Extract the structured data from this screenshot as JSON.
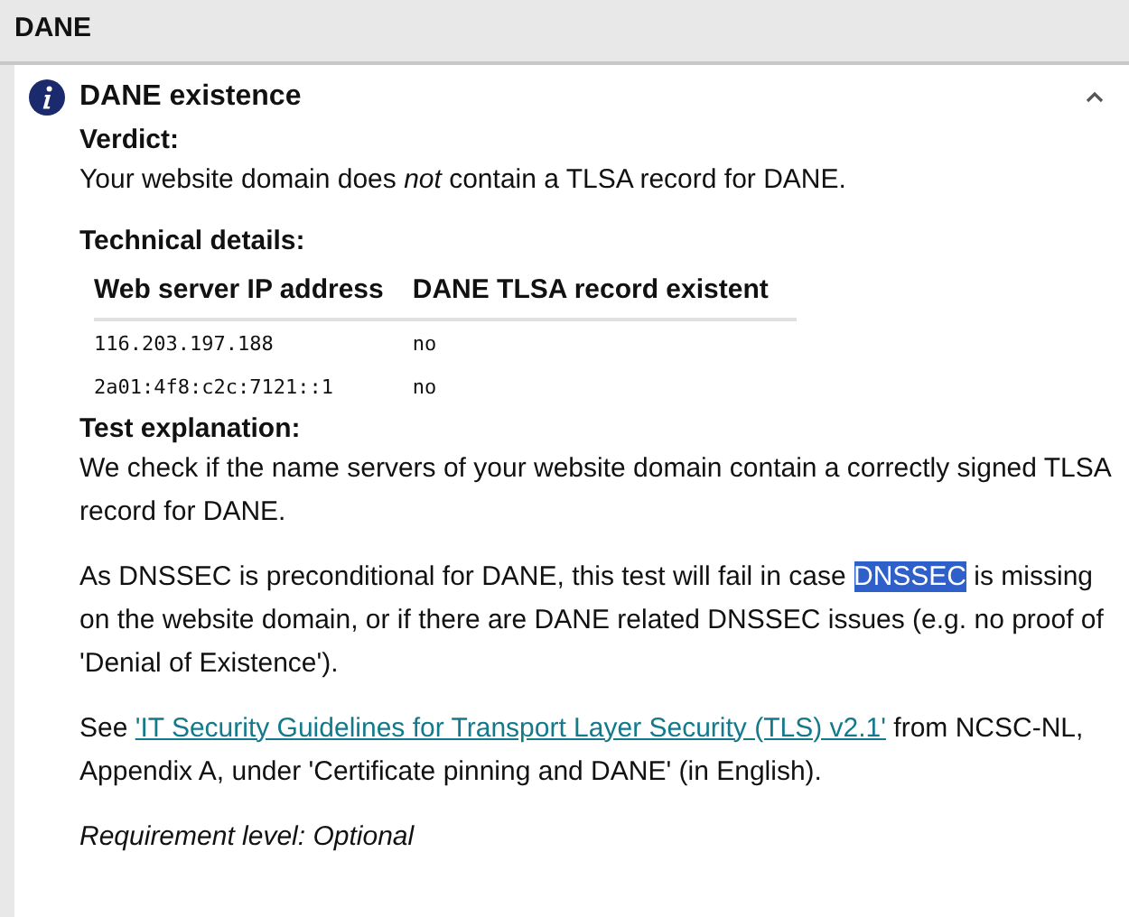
{
  "section": {
    "title": "DANE"
  },
  "test": {
    "title": "DANE existence",
    "expanded": true,
    "verdict_label": "Verdict:",
    "verdict": "Your website domain does *not* contain a TLSA record for DANE.",
    "details_label": "Technical details:",
    "table": {
      "columns": [
        "Web server IP address",
        "DANE TLSA record existent"
      ],
      "rows": [
        [
          "116.203.197.188",
          "no"
        ],
        [
          "2a01:4f8:c2c:7121::1",
          "no"
        ]
      ]
    },
    "explanation_label": "Test explanation:",
    "paragraphs": [
      [
        {
          "kind": "text",
          "text": "We check if the name servers of your website domain contain a correctly signed TLSA record for DANE."
        }
      ],
      [
        {
          "kind": "text",
          "text": "As DNSSEC is preconditional for DANE, this test will fail in case "
        },
        {
          "kind": "selected",
          "text": "DNSSEC"
        },
        {
          "kind": "text",
          "text": " is missing on the website domain, or if there are DANE related DNSSEC issues (e.g. no proof of 'Denial of Existence')."
        }
      ],
      [
        {
          "kind": "text",
          "text": "See "
        },
        {
          "kind": "link",
          "text": "'IT Security Guidelines for Transport Layer Security (TLS) v2.1'"
        },
        {
          "kind": "text",
          "text": " from NCSC-NL, Appendix A, under 'Certificate pinning and DANE' (in English)."
        }
      ]
    ],
    "requirement": "Requirement level: Optional"
  }
}
